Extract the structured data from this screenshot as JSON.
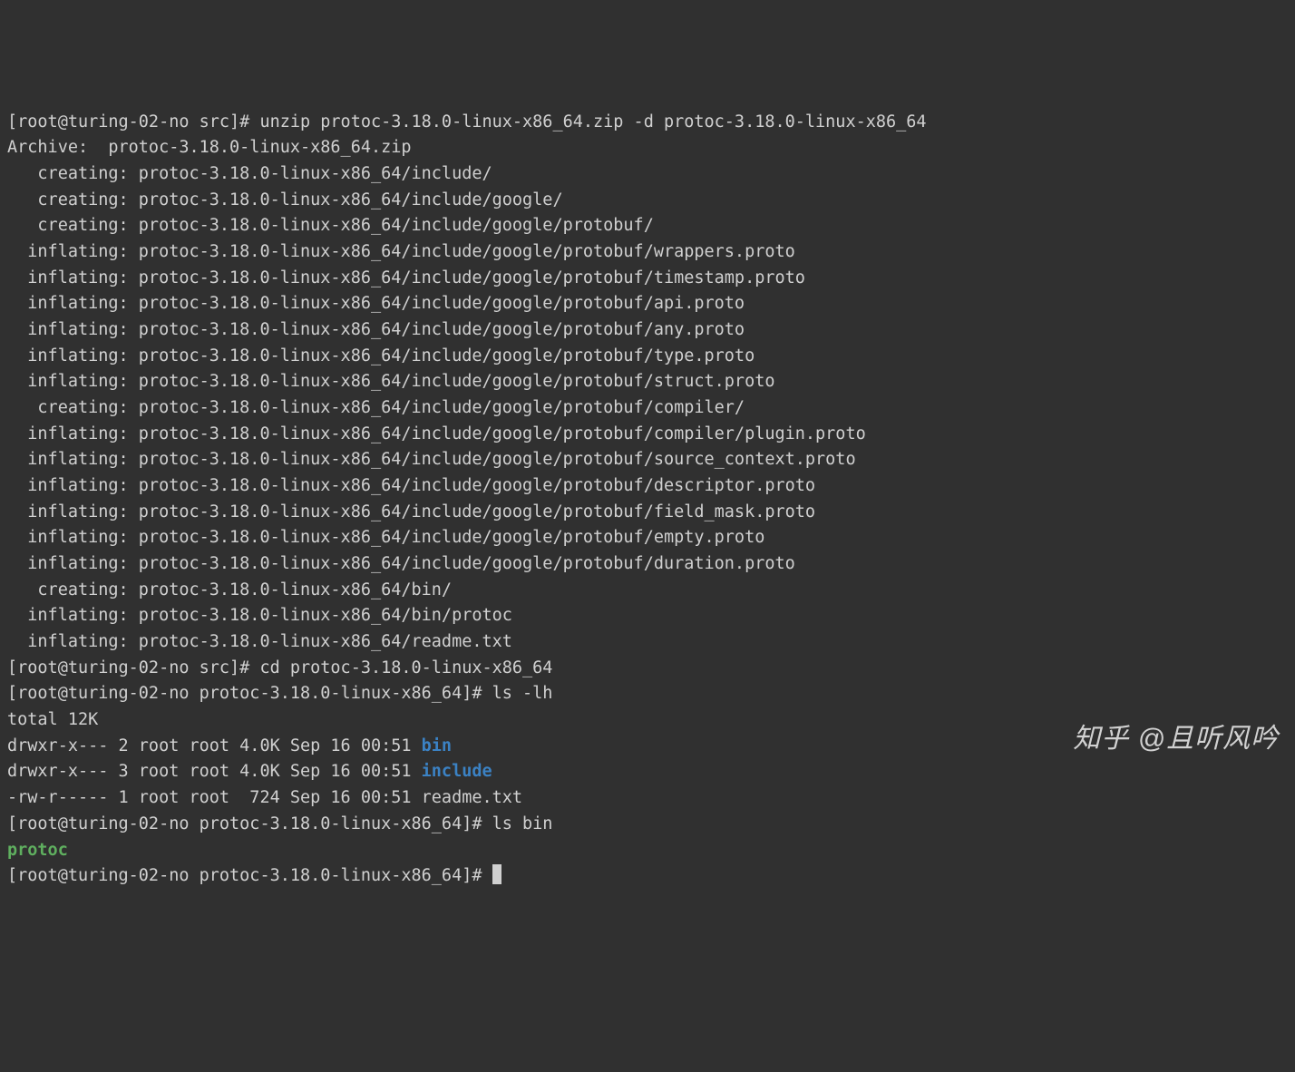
{
  "prompt_src": "[root@turing-02-no src]#",
  "prompt_pkg": "[root@turing-02-no protoc-3.18.0-linux-x86_64]#",
  "cmd": {
    "unzip": "unzip protoc-3.18.0-linux-x86_64.zip -d protoc-3.18.0-linux-x86_64",
    "cd": "cd protoc-3.18.0-linux-x86_64",
    "ls_lh": "ls -lh",
    "ls_bin": "ls bin"
  },
  "archive_line": "Archive:  protoc-3.18.0-linux-x86_64.zip",
  "unzip_lines": [
    "   creating: protoc-3.18.0-linux-x86_64/include/",
    "   creating: protoc-3.18.0-linux-x86_64/include/google/",
    "   creating: protoc-3.18.0-linux-x86_64/include/google/protobuf/",
    "  inflating: protoc-3.18.0-linux-x86_64/include/google/protobuf/wrappers.proto",
    "  inflating: protoc-3.18.0-linux-x86_64/include/google/protobuf/timestamp.proto",
    "  inflating: protoc-3.18.0-linux-x86_64/include/google/protobuf/api.proto",
    "  inflating: protoc-3.18.0-linux-x86_64/include/google/protobuf/any.proto",
    "  inflating: protoc-3.18.0-linux-x86_64/include/google/protobuf/type.proto",
    "  inflating: protoc-3.18.0-linux-x86_64/include/google/protobuf/struct.proto",
    "   creating: protoc-3.18.0-linux-x86_64/include/google/protobuf/compiler/",
    "  inflating: protoc-3.18.0-linux-x86_64/include/google/protobuf/compiler/plugin.proto",
    "  inflating: protoc-3.18.0-linux-x86_64/include/google/protobuf/source_context.proto",
    "  inflating: protoc-3.18.0-linux-x86_64/include/google/protobuf/descriptor.proto",
    "  inflating: protoc-3.18.0-linux-x86_64/include/google/protobuf/field_mask.proto",
    "  inflating: protoc-3.18.0-linux-x86_64/include/google/protobuf/empty.proto",
    "  inflating: protoc-3.18.0-linux-x86_64/include/google/protobuf/duration.proto",
    "   creating: protoc-3.18.0-linux-x86_64/bin/",
    "  inflating: protoc-3.18.0-linux-x86_64/bin/protoc",
    "  inflating: protoc-3.18.0-linux-x86_64/readme.txt"
  ],
  "ls_total": "total 12K",
  "ls_rows": [
    {
      "perm": "drwxr-x--- 2 root root 4.0K Sep 16 00:51 ",
      "name": "bin",
      "cls": "dir"
    },
    {
      "perm": "drwxr-x--- 3 root root 4.0K Sep 16 00:51 ",
      "name": "include",
      "cls": "dir"
    },
    {
      "perm": "-rw-r----- 1 root root  724 Sep 16 00:51 ",
      "name": "readme.txt",
      "cls": ""
    }
  ],
  "ls_bin_out": "protoc",
  "watermark": "知乎 @且听风吟"
}
